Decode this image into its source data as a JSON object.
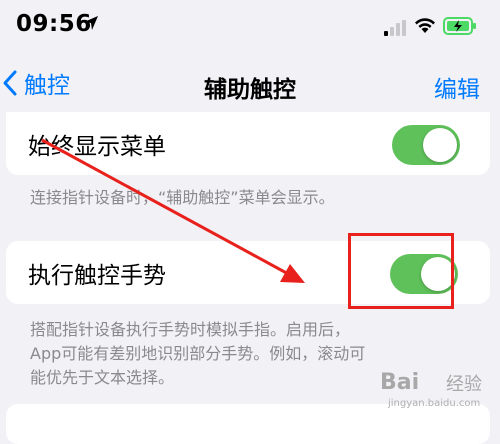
{
  "status_bar": {
    "time": "09:56",
    "battery_charging": true
  },
  "nav": {
    "back_label": "触控",
    "title": "辅助触控",
    "edit_label": "编辑"
  },
  "settings": [
    {
      "label": "始终显示菜单",
      "enabled": true,
      "footer": "连接指针设备时，“辅助触控”菜单会显示。"
    },
    {
      "label": "执行触控手势",
      "enabled": true,
      "footer_lines": [
        "搭配指针设备执行手势时模拟手指。启用后，",
        "App可能有差别地识别部分手势。例如，滚动可",
        "能优先于文本选择。"
      ]
    }
  ],
  "watermark": {
    "logo": "Bai",
    "text": "经验",
    "url": "jingyan.baidu.com"
  },
  "colors": {
    "accent": "#007aff",
    "toggle_on": "#5fc15a",
    "annotation_red": "#e8211c",
    "battery_green": "#4cd964"
  }
}
